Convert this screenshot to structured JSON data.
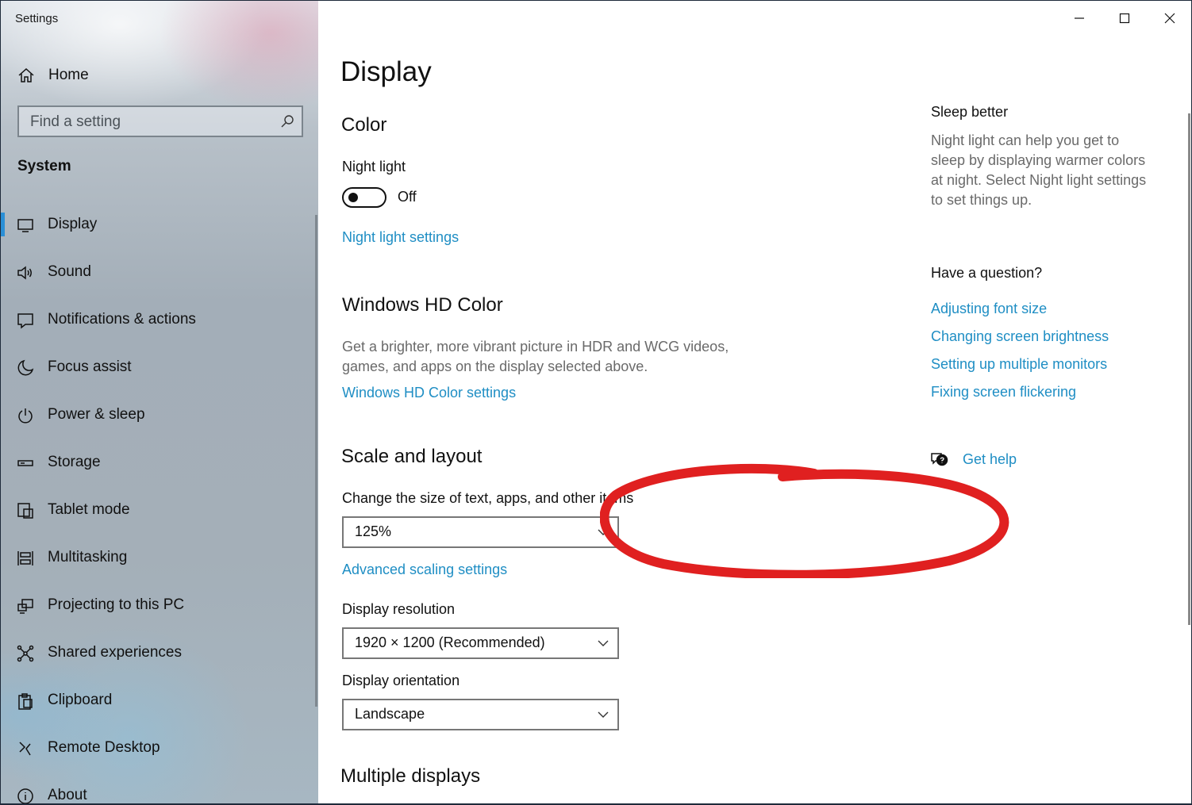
{
  "window": {
    "title": "Settings"
  },
  "sidebar": {
    "home_label": "Home",
    "search_placeholder": "Find a setting",
    "section_label": "System",
    "items": [
      {
        "label": "Display",
        "icon": "monitor-icon",
        "active": true
      },
      {
        "label": "Sound",
        "icon": "speaker-icon"
      },
      {
        "label": "Notifications & actions",
        "icon": "notification-icon"
      },
      {
        "label": "Focus assist",
        "icon": "moon-icon"
      },
      {
        "label": "Power & sleep",
        "icon": "power-icon"
      },
      {
        "label": "Storage",
        "icon": "storage-icon"
      },
      {
        "label": "Tablet mode",
        "icon": "tablet-mode-icon"
      },
      {
        "label": "Multitasking",
        "icon": "multitasking-icon"
      },
      {
        "label": "Projecting to this PC",
        "icon": "projecting-icon"
      },
      {
        "label": "Shared experiences",
        "icon": "shared-experiences-icon"
      },
      {
        "label": "Clipboard",
        "icon": "clipboard-icon"
      },
      {
        "label": "Remote Desktop",
        "icon": "remote-desktop-icon"
      },
      {
        "label": "About",
        "icon": "info-icon"
      }
    ]
  },
  "main": {
    "page_title": "Display",
    "color": {
      "heading": "Color",
      "night_light_label": "Night light",
      "night_light_state": "Off",
      "night_light_settings_link": "Night light settings"
    },
    "hd_color": {
      "heading": "Windows HD Color",
      "description_line1": "Get a brighter, more vibrant picture in HDR and WCG videos,",
      "description_line2": "games, and apps on the display selected above.",
      "settings_link": "Windows HD Color settings"
    },
    "scale_layout": {
      "heading": "Scale and layout",
      "scale_label": "Change the size of text, apps, and other items",
      "scale_value": "125%",
      "advanced_scaling_link": "Advanced scaling settings",
      "resolution_label": "Display resolution",
      "resolution_value": "1920 × 1200 (Recommended)",
      "orientation_label": "Display orientation",
      "orientation_value": "Landscape"
    },
    "multiple_displays_heading": "Multiple displays"
  },
  "right_panel": {
    "sleep_heading": "Sleep better",
    "sleep_text": [
      "Night light can help you get to",
      "sleep by displaying warmer colors",
      "at night. Select Night light settings",
      "to set things up."
    ],
    "question_heading": "Have a question?",
    "links": [
      "Adjusting font size",
      "Changing screen brightness",
      "Setting up multiple monitors",
      "Fixing screen flickering"
    ],
    "get_help_label": "Get help"
  },
  "colors": {
    "accent_link": "#1f8ec4",
    "selection_bar": "#2a8fd6",
    "annotation": "#e02020"
  }
}
